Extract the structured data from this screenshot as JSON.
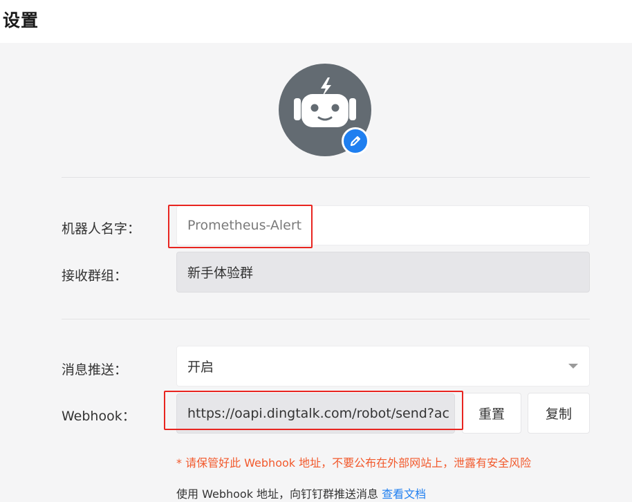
{
  "page": {
    "title": "设置"
  },
  "avatar": {
    "icon": "robot-icon",
    "edit_icon": "pencil-icon",
    "avatar_bg": "#636b72",
    "edit_badge_color": "#1f7ff0"
  },
  "form": {
    "robot_name": {
      "label": "机器人名字：",
      "placeholder": "Prometheus-Alert",
      "value": ""
    },
    "receive_group": {
      "label": "接收群组：",
      "value": "新手体验群"
    },
    "message_push": {
      "label": "消息推送：",
      "value": "开启"
    },
    "webhook": {
      "label": "Webhook：",
      "value": "https://oapi.dingtalk.com/robot/send?ac",
      "reset_label": "重置",
      "copy_label": "复制"
    }
  },
  "notes": {
    "warning": "* 请保管好此 Webhook 地址，不要公布在外部网站上，泄露有安全风险",
    "hint_text": "使用 Webhook 地址，向钉钉群推送消息",
    "hint_link": "查看文档"
  },
  "colors": {
    "highlight_box": "#e8241f",
    "link": "#1f7ff0",
    "warning": "#f2592c"
  }
}
